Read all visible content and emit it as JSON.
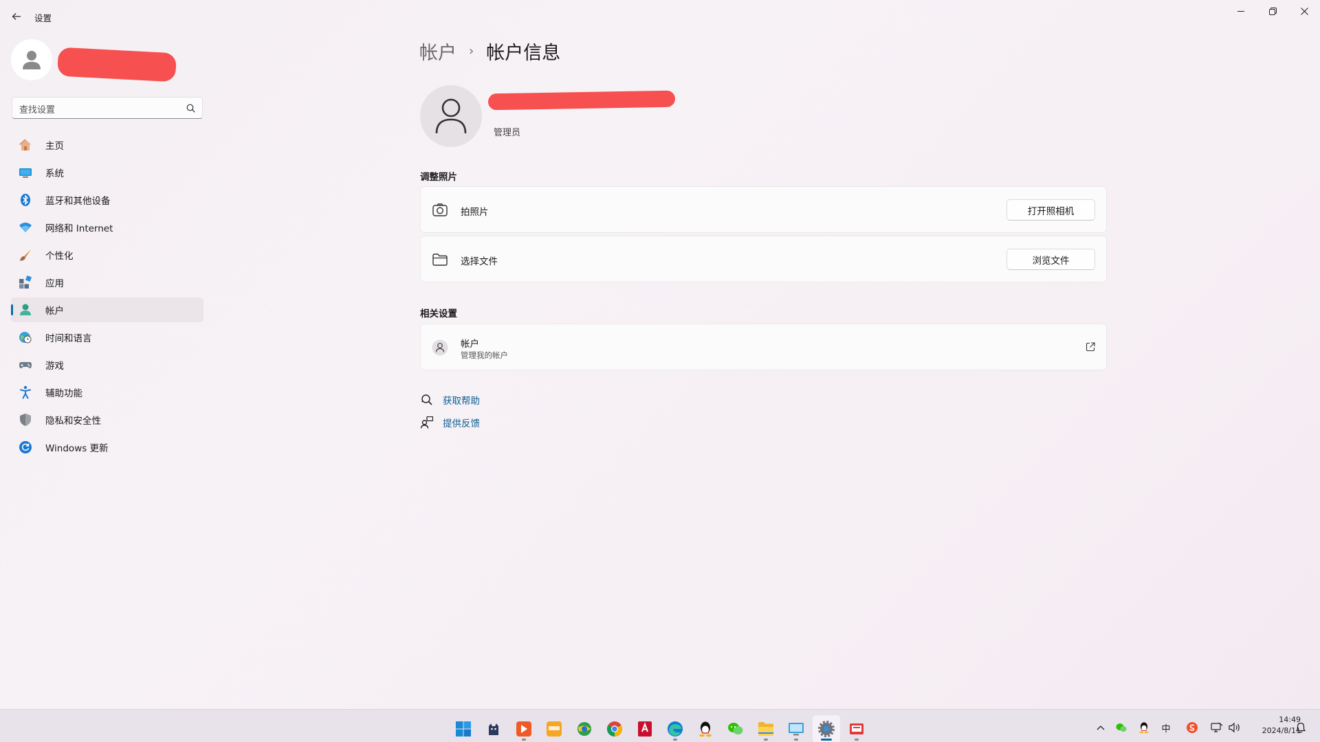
{
  "window": {
    "title": "设置",
    "back_icon": "arrow-left-icon",
    "minimize_icon": "minimize-icon",
    "restore_icon": "restore-icon",
    "close_icon": "close-icon"
  },
  "profile": {
    "avatar_icon": "person-icon",
    "name_redacted": true
  },
  "search": {
    "placeholder": "查找设置",
    "icon": "search-icon"
  },
  "sidebar": {
    "items": [
      {
        "label": "主页",
        "icon": "home-icon",
        "active": false
      },
      {
        "label": "系统",
        "icon": "system-monitor-icon",
        "active": false
      },
      {
        "label": "蓝牙和其他设备",
        "icon": "bluetooth-icon",
        "active": false
      },
      {
        "label": "网络和 Internet",
        "icon": "wifi-icon",
        "active": false
      },
      {
        "label": "个性化",
        "icon": "brush-icon",
        "active": false
      },
      {
        "label": "应用",
        "icon": "apps-icon",
        "active": false
      },
      {
        "label": "帐户",
        "icon": "account-icon",
        "active": true
      },
      {
        "label": "时间和语言",
        "icon": "globe-clock-icon",
        "active": false
      },
      {
        "label": "游戏",
        "icon": "gamepad-icon",
        "active": false
      },
      {
        "label": "辅助功能",
        "icon": "accessibility-icon",
        "active": false
      },
      {
        "label": "隐私和安全性",
        "icon": "shield-icon",
        "active": false
      },
      {
        "label": "Windows 更新",
        "icon": "update-icon",
        "active": false
      }
    ]
  },
  "breadcrumb": {
    "parent": "帐户",
    "separator": "›",
    "current": "帐户信息"
  },
  "account": {
    "role": "管理员",
    "avatar_icon": "person-outline-icon",
    "name_redacted": true
  },
  "adjust_photo": {
    "title": "调整照片",
    "rows": [
      {
        "label": "拍照片",
        "icon": "camera-icon",
        "button": "打开照相机"
      },
      {
        "label": "选择文件",
        "icon": "folder-icon",
        "button": "浏览文件"
      }
    ]
  },
  "related": {
    "title": "相关设置",
    "row": {
      "label": "帐户",
      "sublabel": "管理我的帐户",
      "icon": "person-circle-icon",
      "action_icon": "open-external-icon"
    }
  },
  "links": {
    "help": "获取帮助",
    "feedback": "提供反馈"
  },
  "taskbar": {
    "apps": [
      {
        "name": "start-icon"
      },
      {
        "name": "cat-app-icon"
      },
      {
        "name": "video-app-icon"
      },
      {
        "name": "enjoy-app-icon"
      },
      {
        "name": "browser-globe-icon"
      },
      {
        "name": "chrome-icon"
      },
      {
        "name": "autocad-icon"
      },
      {
        "name": "edge-icon"
      },
      {
        "name": "qq-icon"
      },
      {
        "name": "wechat-icon"
      },
      {
        "name": "file-explorer-icon"
      },
      {
        "name": "remote-desktop-icon"
      },
      {
        "name": "settings-gear-icon"
      },
      {
        "name": "toolbox-app-icon"
      }
    ],
    "tray_icons": [
      "chevron-up-icon",
      "wechat-tray-icon",
      "qq-tray-icon",
      "ime-icon",
      "sogou-icon",
      "network-icon",
      "volume-icon"
    ],
    "ime_label": "中",
    "time": "14:49",
    "date": "2024/8/11",
    "notification_icon": "bell-icon"
  },
  "colors": {
    "accent": "#0e6aa8",
    "link": "#0a5d93",
    "redaction": "#f65050"
  }
}
